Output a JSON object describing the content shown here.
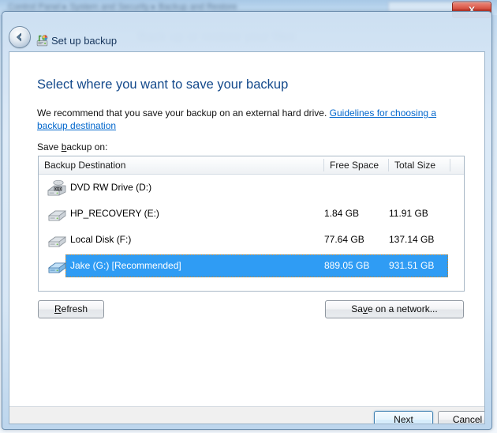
{
  "background_window": {
    "breadcrumb": "Control Panel  ▸  System and Security  ▸  Backup and Restore",
    "heading": "Back up or restore your files"
  },
  "window": {
    "close_label": "X",
    "title": "Set up backup",
    "back_icon": "back-arrow-icon",
    "title_icon": "backup-icon"
  },
  "page": {
    "heading": "Select where you want to save your backup",
    "intro_prefix": "We recommend that you save your backup on an external hard drive. ",
    "intro_link": "Guidelines for choosing a backup destination",
    "save_label_prefix": "Save ",
    "save_label_accel": "b",
    "save_label_suffix": "ackup on:"
  },
  "table": {
    "columns": [
      "Backup Destination",
      "Free Space",
      "Total Size",
      ""
    ],
    "rows": [
      {
        "icon": "dvd-drive-icon",
        "name": "DVD RW Drive (D:)",
        "free_space": "",
        "total_size": "",
        "selected": false
      },
      {
        "icon": "hard-drive-icon",
        "name": "HP_RECOVERY (E:)",
        "free_space": "1.84 GB",
        "total_size": "11.91 GB",
        "selected": false
      },
      {
        "icon": "hard-drive-icon",
        "name": "Local Disk (F:)",
        "free_space": "77.64 GB",
        "total_size": "137.14 GB",
        "selected": false
      },
      {
        "icon": "external-drive-icon",
        "name": "Jake (G:) [Recommended]",
        "free_space": "889.05 GB",
        "total_size": "931.51 GB",
        "selected": true
      }
    ]
  },
  "buttons": {
    "refresh_accel": "R",
    "refresh_rest": "efresh",
    "network_pre": "Sa",
    "network_accel": "v",
    "network_rest": "e on a network...",
    "next_accel": "N",
    "next_rest": "ext",
    "cancel": "Cancel"
  },
  "colors": {
    "selection": "#2f9cf4",
    "focus_outline": "#c8882a",
    "heading": "#13498b",
    "link": "#0066cc",
    "close_button": "#c22f1d"
  }
}
